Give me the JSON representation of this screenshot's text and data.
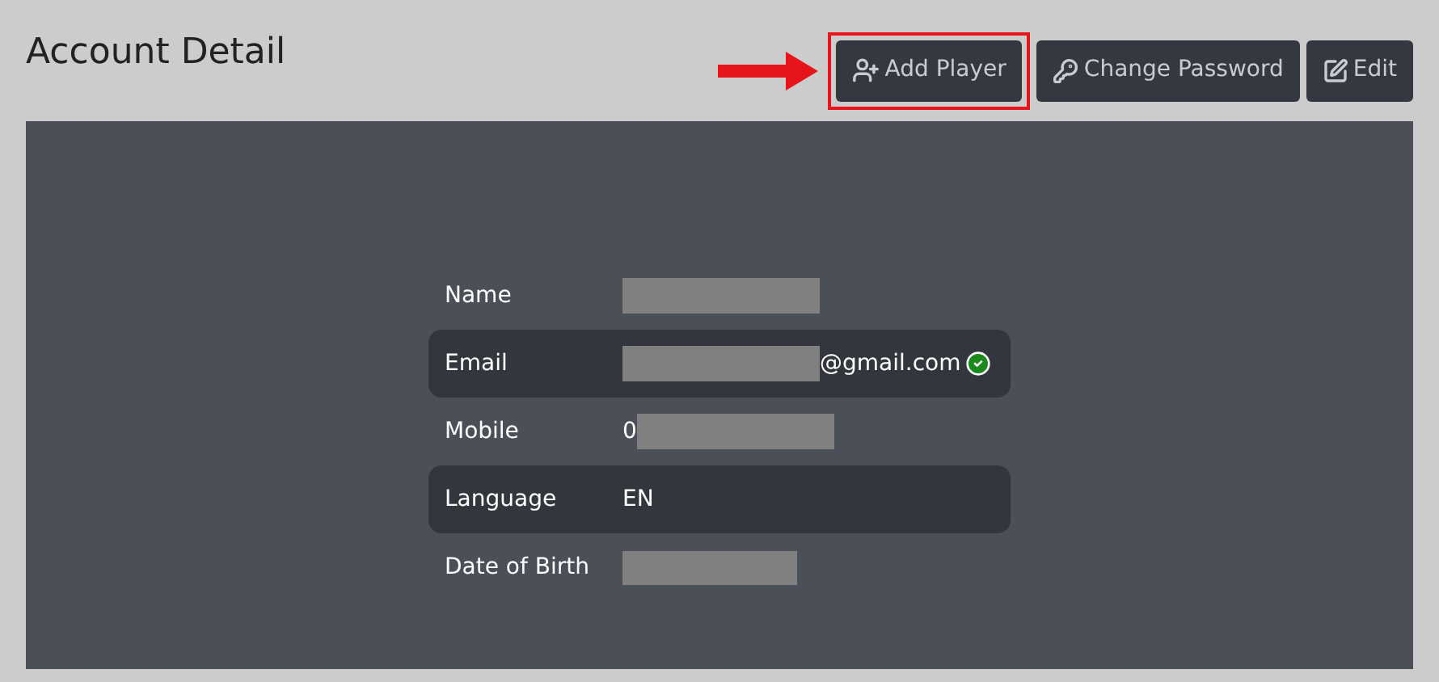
{
  "title": "Account Detail",
  "buttons": [
    {
      "label": "Add Player",
      "kind": "add-user",
      "highlighted": true
    },
    {
      "label": "Change Password",
      "kind": "key",
      "highlighted": false
    },
    {
      "label": "Edit",
      "kind": "edit",
      "highlighted": false
    }
  ],
  "details": [
    {
      "label": "Name",
      "parts": [
        {
          "kind": "redacted"
        }
      ],
      "verified": false
    },
    {
      "label": "Email",
      "parts": [
        {
          "kind": "redacted"
        },
        {
          "kind": "text",
          "text": "@gmail.com"
        }
      ],
      "verified": true
    },
    {
      "label": "Mobile",
      "parts": [
        {
          "kind": "text",
          "text": "0"
        },
        {
          "kind": "redacted"
        }
      ],
      "verified": false
    },
    {
      "label": "Language",
      "parts": [
        {
          "kind": "text",
          "text": "EN"
        }
      ],
      "verified": false
    },
    {
      "label": "Date of Birth",
      "parts": [
        {
          "kind": "redacted-short"
        }
      ],
      "verified": false
    }
  ]
}
